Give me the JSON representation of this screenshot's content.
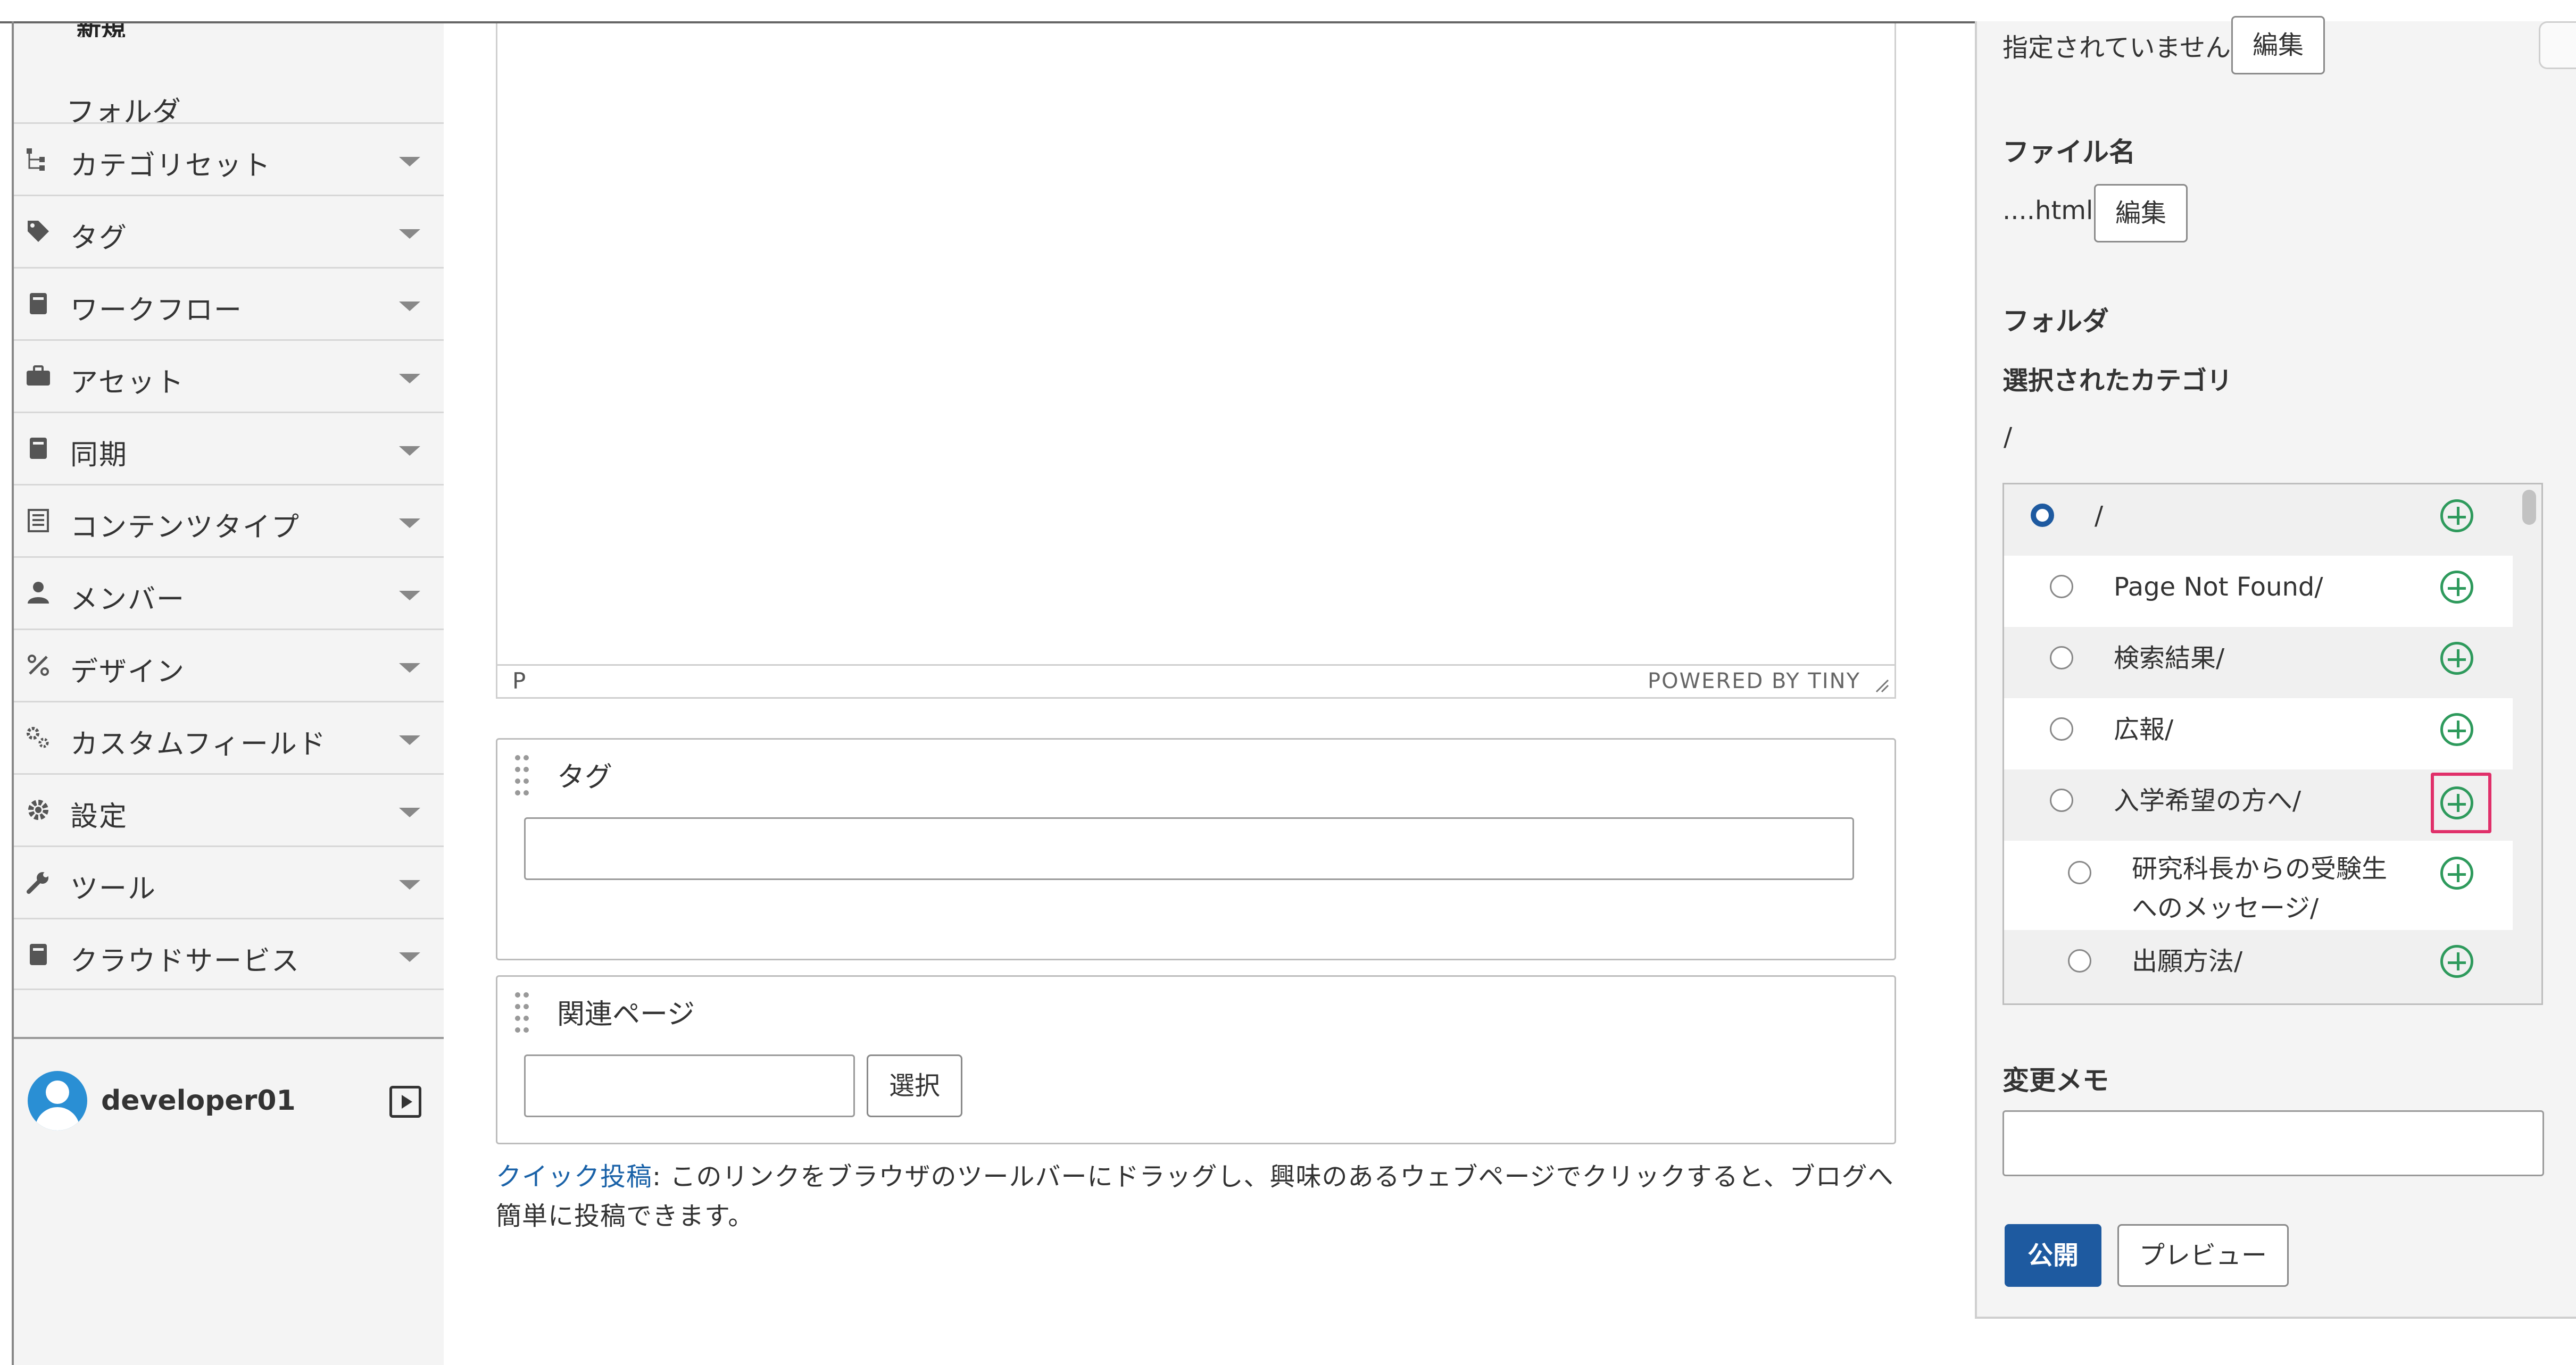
{
  "sidebar": {
    "partial_heading": "新規",
    "folder_label": "フォルダ",
    "items": [
      {
        "label": "カテゴリセット",
        "icon": "category-tree-icon"
      },
      {
        "label": "タグ",
        "icon": "tag-icon"
      },
      {
        "label": "ワークフロー",
        "icon": "workflow-icon"
      },
      {
        "label": "アセット",
        "icon": "asset-briefcase-icon"
      },
      {
        "label": "同期",
        "icon": "sync-icon"
      },
      {
        "label": "コンテンツタイプ",
        "icon": "content-type-icon"
      },
      {
        "label": "メンバー",
        "icon": "member-icon"
      },
      {
        "label": "デザイン",
        "icon": "design-icon"
      },
      {
        "label": "カスタムフィールド",
        "icon": "custom-field-gears-icon"
      },
      {
        "label": "設定",
        "icon": "settings-gear-icon"
      },
      {
        "label": "ツール",
        "icon": "wrench-icon"
      },
      {
        "label": "クラウドサービス",
        "icon": "cloud-service-icon"
      }
    ],
    "user": {
      "name": "developer01"
    }
  },
  "editor": {
    "status_path": "P",
    "powered_by": "POWERED BY TINY"
  },
  "tags_box": {
    "title": "タグ",
    "value": ""
  },
  "related_box": {
    "title": "関連ページ",
    "value": "",
    "select_label": "選択"
  },
  "quickpost": {
    "link_text": "クイック投稿",
    "text": ": このリンクをブラウザのツールバーにドラッグし、興味のあるウェブページでクリックすると、ブログへ簡単に投稿できます。"
  },
  "right": {
    "unspecified_text": "指定されていません",
    "edit_label": "編集",
    "filename_label": "ファイル名",
    "filename_value": "....html",
    "folder_label": "フォルダ",
    "selected_category_label": "選択されたカテゴリ",
    "selected_category_value": "/",
    "categories": [
      {
        "label": "/",
        "selected": true
      },
      {
        "label": "Page Not Found/",
        "selected": false
      },
      {
        "label": "検索結果/",
        "selected": false
      },
      {
        "label": "広報/",
        "selected": false
      },
      {
        "label": "入学希望の方へ/",
        "selected": false,
        "highlighted": true
      },
      {
        "label": "研究科長からの受験生へのメッセージ/",
        "selected": false
      },
      {
        "label": "出願方法/",
        "selected": false
      }
    ],
    "memo_label": "変更メモ",
    "memo_value": "",
    "publish_label": "公開",
    "preview_label": "プレビュー"
  },
  "colors": {
    "accent": "#1e5aa0",
    "add_icon": "#2e9a5c",
    "highlight": "#e0306a",
    "link": "#1a62a8"
  }
}
